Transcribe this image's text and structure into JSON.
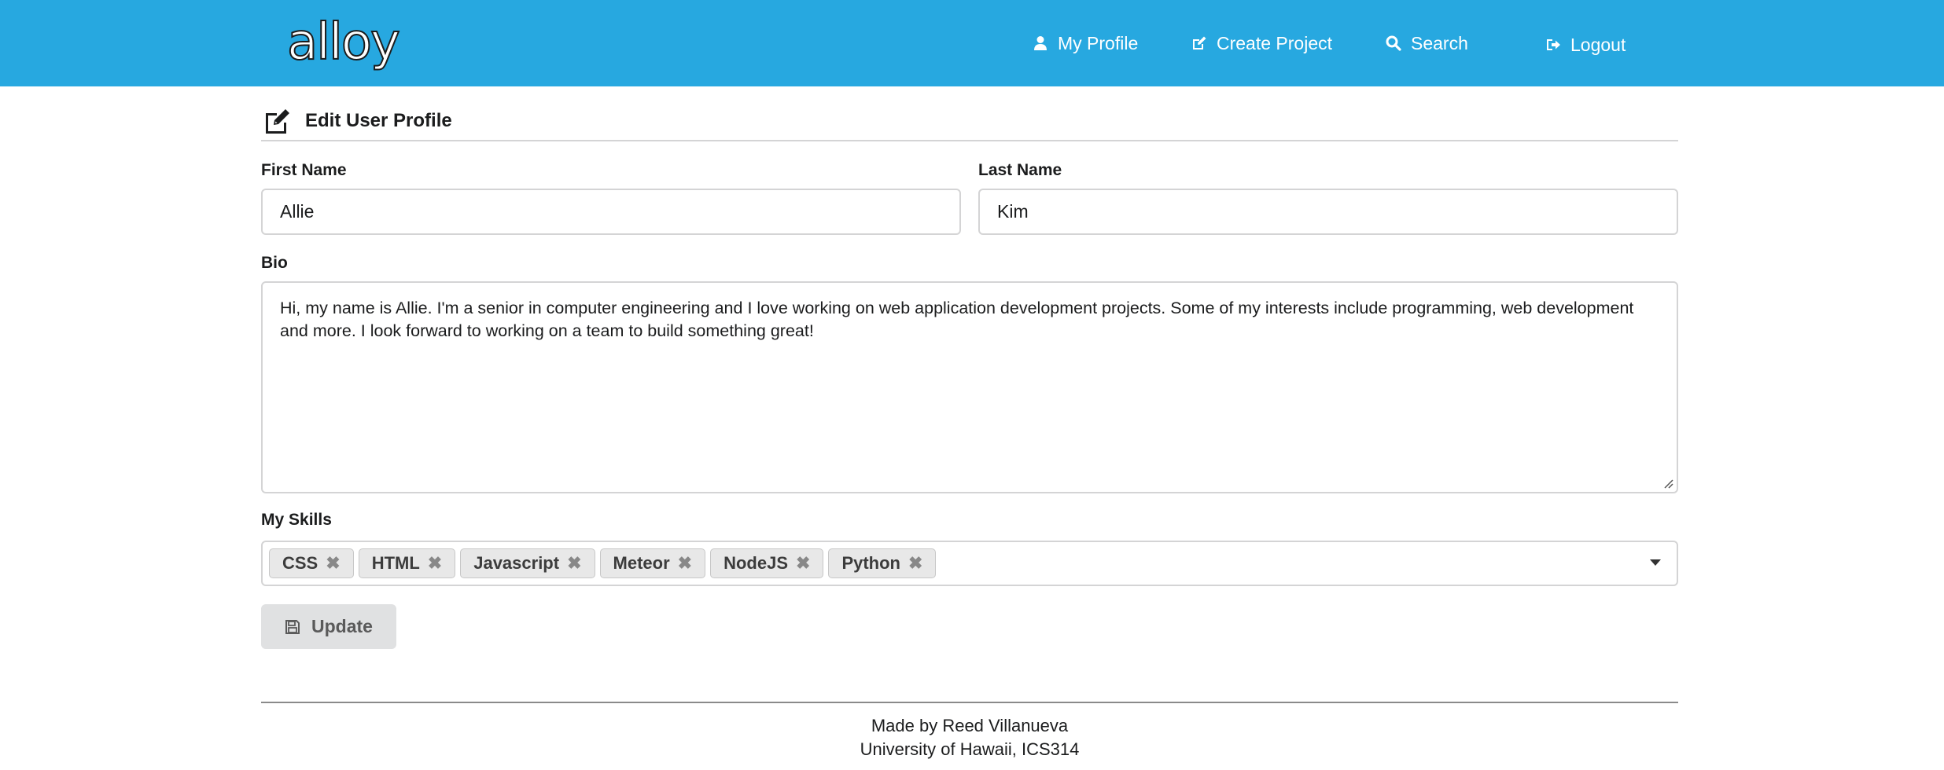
{
  "app": {
    "logo_text": "alloy"
  },
  "nav": {
    "items": [
      {
        "label": "My Profile",
        "icon": "user-icon"
      },
      {
        "label": "Create Project",
        "icon": "edit-icon"
      },
      {
        "label": "Search",
        "icon": "search-icon"
      },
      {
        "label": "Logout",
        "icon": "sign-out-icon"
      }
    ]
  },
  "header": {
    "title": "Edit User Profile",
    "icon": "edit-icon"
  },
  "form": {
    "first_name": {
      "label": "First Name",
      "value": "Allie"
    },
    "last_name": {
      "label": "Last Name",
      "value": "Kim"
    },
    "bio": {
      "label": "Bio",
      "value": "Hi, my name is Allie. I'm a senior in computer engineering and I love working on web application development projects. Some of my interests include programming, web development and more. I look forward to working on a team to build something great!"
    },
    "skills": {
      "label": "My Skills",
      "selected": [
        "CSS",
        "HTML",
        "Javascript",
        "Meteor",
        "NodeJS",
        "Python"
      ],
      "remove_glyph": "✖"
    },
    "update_label": "Update"
  },
  "footer": {
    "line1": "Made by Reed Villanueva",
    "line2": "University of Hawaii, ICS314"
  },
  "colors": {
    "accent": "#27a8e0",
    "button_bg": "#e0e1e2",
    "chip_bg": "#e8e8e8",
    "border": "#d4d4d5"
  }
}
